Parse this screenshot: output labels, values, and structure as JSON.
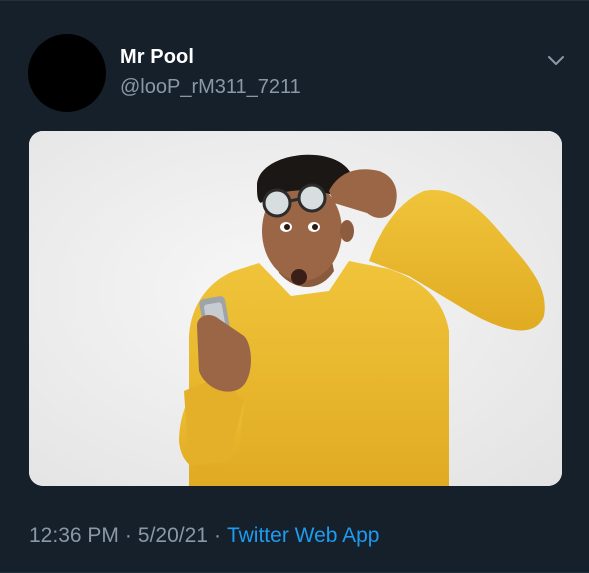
{
  "tweet": {
    "author": {
      "display_name": "Mr Pool",
      "handle": "@looP_rM311_7211",
      "avatar_icon": "avatar-placeholder"
    },
    "menu_icon": "chevron-down-icon",
    "media": {
      "type": "photo"
    },
    "meta": {
      "time": "12:36 PM",
      "separator": "·",
      "date": "5/20/21",
      "source": "Twitter Web App"
    }
  },
  "colors": {
    "background": "#15202b",
    "primary_text": "#ffffff",
    "secondary_text": "#8b98a5",
    "link": "#1d9bf0"
  }
}
